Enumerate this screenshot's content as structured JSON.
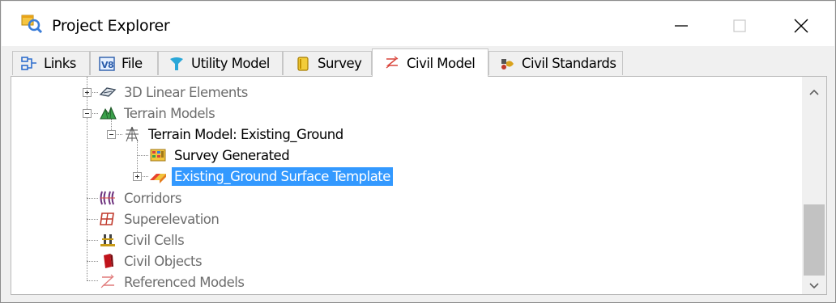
{
  "window": {
    "title": "Project Explorer",
    "title_icon": "project-explorer-icon",
    "controls": [
      "minimize",
      "maximize",
      "close"
    ]
  },
  "tabs": [
    {
      "label": "Links",
      "icon": "links-icon",
      "active": false
    },
    {
      "label": "File",
      "icon": "file-v8-icon",
      "active": false
    },
    {
      "label": "Utility Model",
      "icon": "utility-model-icon",
      "active": false
    },
    {
      "label": "Survey",
      "icon": "survey-icon",
      "active": false
    },
    {
      "label": "Civil Model",
      "icon": "civil-model-icon",
      "active": true
    },
    {
      "label": "Civil Standards",
      "icon": "civil-standards-icon",
      "active": false
    }
  ],
  "tree": {
    "nodes": [
      {
        "label": "3D Linear Elements",
        "icon": "linear-elements-icon",
        "state": "collapsed"
      },
      {
        "label": "Terrain Models",
        "icon": "terrain-models-icon",
        "state": "expanded"
      },
      {
        "label": "Terrain Model: Existing_Ground",
        "icon": "terrain-model-icon",
        "state": "expanded"
      },
      {
        "label": "Survey Generated",
        "icon": "survey-generated-icon",
        "state": "leaf"
      },
      {
        "label": "Existing_Ground Surface Template",
        "icon": "surface-template-icon",
        "state": "collapsed",
        "selected": true
      },
      {
        "label": "Corridors",
        "icon": "corridors-icon",
        "state": "leaf"
      },
      {
        "label": "Superelevation",
        "icon": "superelevation-icon",
        "state": "leaf"
      },
      {
        "label": "Civil Cells",
        "icon": "civil-cells-icon",
        "state": "leaf"
      },
      {
        "label": "Civil Objects",
        "icon": "civil-objects-icon",
        "state": "leaf"
      },
      {
        "label": "Referenced Models",
        "icon": "referenced-models-icon",
        "state": "leaf"
      }
    ]
  },
  "colors": {
    "selection": "#3399ff",
    "disabled_text": "#6d6d6d",
    "scroll_thumb": "#c2c2c2"
  }
}
